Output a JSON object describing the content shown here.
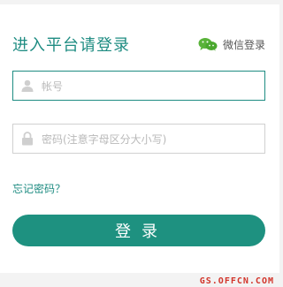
{
  "header": {
    "title": "进入平台请登录",
    "wechat_label": "微信登录",
    "wechat_icon": "wechat-icon"
  },
  "form": {
    "account_placeholder": "帐号",
    "account_icon": "user-icon",
    "password_placeholder": "密码(注意字母区分大小写)",
    "password_icon": "lock-icon",
    "forgot_label": "忘记密码？",
    "login_label": "登录"
  },
  "watermark": {
    "text": "GS.OFFCN.COM"
  },
  "colors": {
    "accent": "#1e8c82",
    "button": "#1e9180",
    "watermark": "#d2352b"
  }
}
